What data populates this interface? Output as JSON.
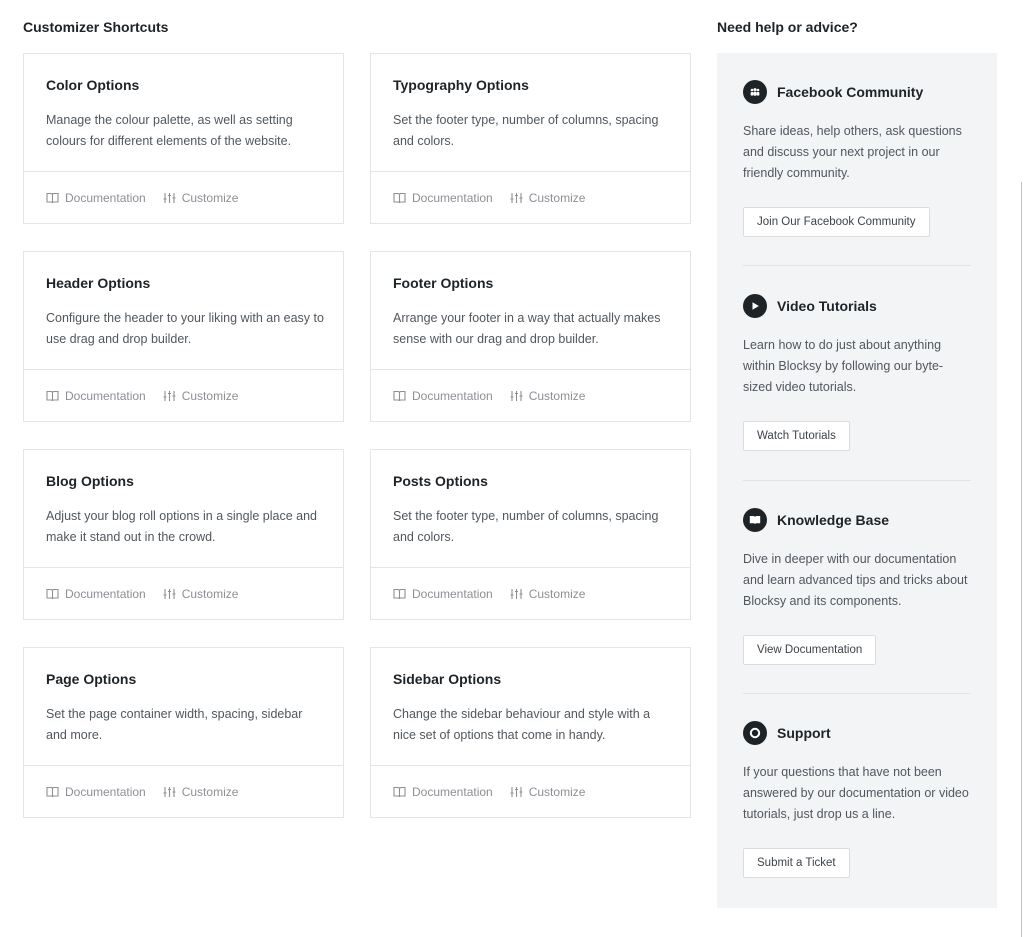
{
  "shortcuts": {
    "title": "Customizer Shortcuts",
    "doc_label": "Documentation",
    "customize_label": "Customize",
    "cards": [
      {
        "title": "Color Options",
        "desc": "Manage the colour palette, as well as setting colours for different elements of the website."
      },
      {
        "title": "Typography Options",
        "desc": "Set the footer type, number of columns, spacing and colors."
      },
      {
        "title": "Header Options",
        "desc": "Configure the header to your liking with an easy to use drag and drop builder."
      },
      {
        "title": "Footer Options",
        "desc": "Arrange your footer in a way that actually makes sense with our drag and drop builder."
      },
      {
        "title": "Blog Options",
        "desc": "Adjust your blog roll options in a single place and make it stand out in the crowd."
      },
      {
        "title": "Posts Options",
        "desc": "Set the footer type, number of columns, spacing and colors."
      },
      {
        "title": "Page Options",
        "desc": "Set the page container width, spacing, sidebar and more."
      },
      {
        "title": "Sidebar Options",
        "desc": "Change the sidebar behaviour and style with a nice set of options that come in handy."
      }
    ]
  },
  "help": {
    "title": "Need help or advice?",
    "items": [
      {
        "icon": "users-icon",
        "title": "Facebook Community",
        "desc": "Share ideas, help others, ask questions and discuss your next project in our friendly community.",
        "button": "Join Our Facebook Community"
      },
      {
        "icon": "play-icon",
        "title": "Video Tutorials",
        "desc": "Learn how to do just about anything within Blocksy by following our byte-sized video tutorials.",
        "button": "Watch Tutorials"
      },
      {
        "icon": "book-icon",
        "title": "Knowledge Base",
        "desc": "Dive in deeper with our documentation and learn advanced tips and tricks about Blocksy and its components.",
        "button": "View Documentation"
      },
      {
        "icon": "lifebuoy-icon",
        "title": "Support",
        "desc": "If your questions that have not been answered by our documentation or video tutorials, just drop us a line.",
        "button": "Submit a Ticket"
      }
    ]
  }
}
